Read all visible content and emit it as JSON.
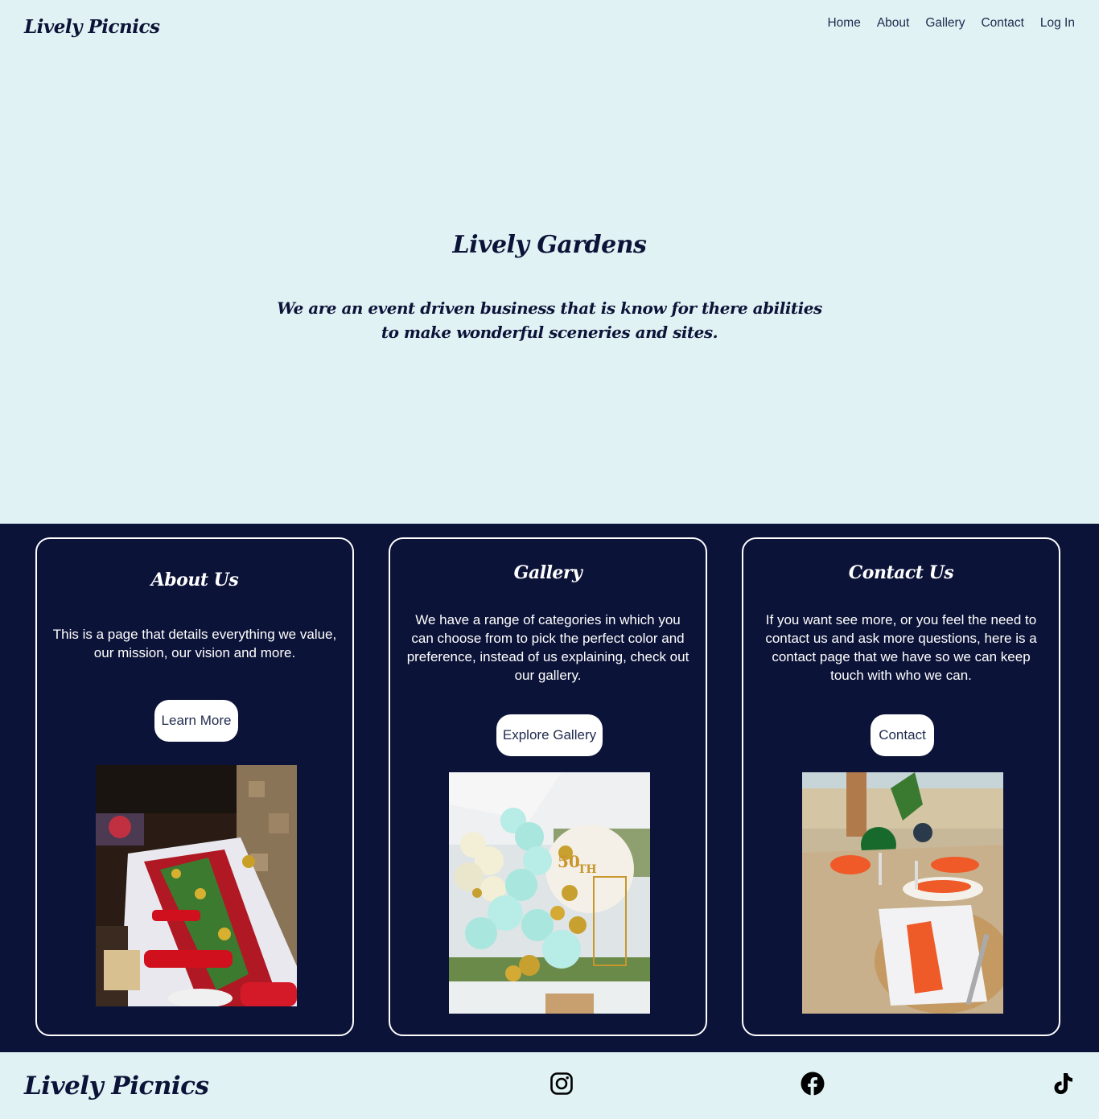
{
  "brand": "Lively Picnics",
  "nav": {
    "items": [
      "Home",
      "About",
      "Gallery",
      "Contact",
      "Log In"
    ]
  },
  "hero": {
    "title": "Lively Gardens",
    "text": "We are an event driven business that is know for there abilities to make wonderful sceneries and sites."
  },
  "cards": [
    {
      "title": "About Us",
      "text": "This is a page that details everything we value, our mission, our vision and more.",
      "button": "Learn More",
      "image": "banquet-table-photo"
    },
    {
      "title": "Gallery",
      "text": "We have a range of categories in which you can choose from to pick the perfect color and preference, instead of us explaining, check out our gallery.",
      "button": "Explore Gallery",
      "image": "balloon-arch-photo"
    },
    {
      "title": "Contact Us",
      "text": "If you want see more, or you feel the need to contact us and ask more questions, here is a contact page that we have so we can keep touch with who we can.",
      "button": "Contact",
      "image": "table-setting-photo"
    }
  ],
  "footer": {
    "brand": "Lively Picnics",
    "social": [
      "instagram-icon",
      "facebook-icon",
      "tiktok-icon"
    ]
  },
  "colors": {
    "background": "#e1f2f4",
    "navy": "#0c1338",
    "white": "#ffffff"
  }
}
